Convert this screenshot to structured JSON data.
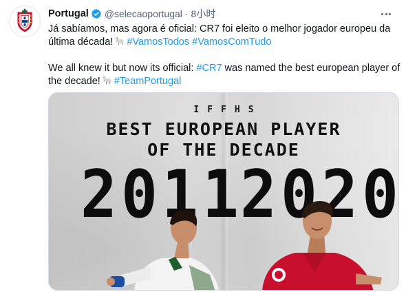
{
  "tweet": {
    "display_name": "Portugal",
    "handle": "@selecaoportugal",
    "separator": "·",
    "time": "8小时",
    "paragraphs": [
      {
        "parts": [
          {
            "type": "text",
            "value": "Já sabíamos, mas agora é oficial: CR7 foi eleito o melhor jogador europeu da última década!"
          },
          {
            "type": "emoji",
            "name": "goat-emoji"
          },
          {
            "type": "link",
            "value": "#VamosTodos"
          },
          {
            "type": "text",
            "value": " "
          },
          {
            "type": "link",
            "value": "#VamosComTudo"
          }
        ]
      },
      {
        "parts": [
          {
            "type": "text",
            "value": "We all knew it but now its official: "
          },
          {
            "type": "link",
            "value": "#CR7"
          },
          {
            "type": "text",
            "value": " was named the best european player of the decade!"
          },
          {
            "type": "emoji",
            "name": "goat-emoji"
          },
          {
            "type": "link",
            "value": "#TeamPortugal"
          }
        ]
      }
    ],
    "media": {
      "org": "IFFHS",
      "headline_line1": "BEST EUROPEAN PLAYER",
      "headline_line2": "OF THE DECADE",
      "year_start": "2011",
      "year_end": "2020"
    }
  },
  "colors": {
    "link": "#1d9bf0",
    "text": "#0f1419",
    "secondary": "#536471",
    "verified": "#1d9bf0",
    "portugal_red": "#c8102e",
    "portugal_green": "#046a38"
  },
  "icons": {
    "avatar": "portugal-federation-crest",
    "verified": "verified-badge-icon",
    "more": "more-options-icon",
    "emoji": "goat-emoji"
  }
}
